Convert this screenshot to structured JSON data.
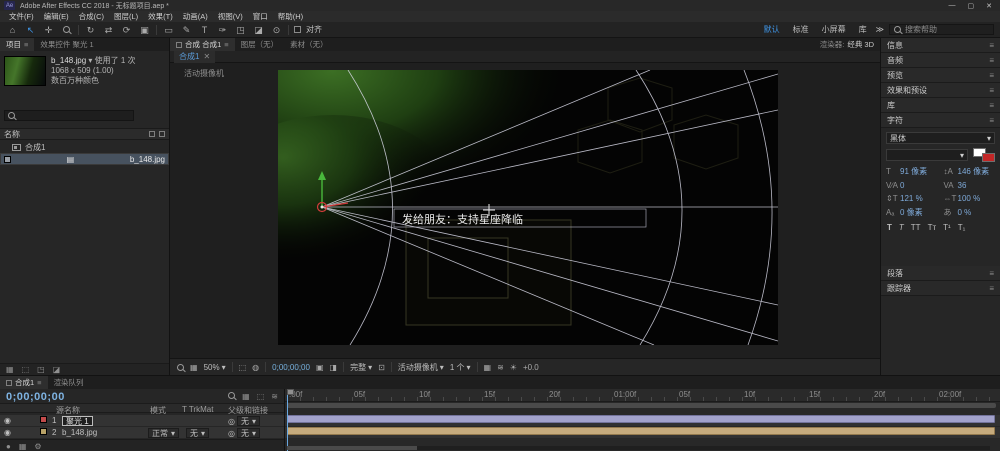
{
  "colors": {
    "accent_blue": "#3f96e8",
    "timecode_blue": "#7eb3e2",
    "layer_bar_lavender": "#a2a2cb",
    "layer_bar_tan": "#c6ab7d"
  },
  "icons": {
    "menu": "≡",
    "chevron": "▾",
    "close": "✕",
    "minimize": "—",
    "maximize": "▢",
    "home": "⌂",
    "selection": "↖",
    "hand": "✛",
    "orbit": "↻",
    "pan": "⇄",
    "rotate": "⟳",
    "camera_tool": "▣",
    "rect_tool": "▭",
    "pen_tool": "✎",
    "type_tool": "T",
    "brush_tool": "✑",
    "stamp_tool": "◳",
    "eraser_tool": "◪",
    "puppet_tool": "⊙",
    "overflow": "≫",
    "grid": "▦",
    "safe_margins": "⬚",
    "channels": "◍",
    "snapshot": "▣",
    "split_view": "◨",
    "roi": "⊡",
    "gear": "⚙",
    "sun": "☀",
    "eye": "◉",
    "pickwhip": "◎",
    "film": "▤",
    "solo_dot": "●",
    "quality": "≋"
  },
  "titlebar": {
    "app_badge": "Ae",
    "title": "Adobe After Effects CC 2018 - 无标题项目.aep *"
  },
  "menubar": {
    "items": [
      "文件(F)",
      "编辑(E)",
      "合成(C)",
      "图层(L)",
      "效果(T)",
      "动画(A)",
      "视图(V)",
      "窗口",
      "帮助(H)"
    ]
  },
  "toolbar": {
    "snap_label": "对齐",
    "workspaces": [
      "默认",
      "标准",
      "小屏幕",
      "库"
    ],
    "search_placeholder": "搜索帮助"
  },
  "project": {
    "tab_project": "项目",
    "tab_effect_controls": "效果控件 聚光 1",
    "preview_name": "b_148.jpg",
    "preview_usage": "使用了 1 次",
    "preview_dimensions": "1068 x 509 (1.00)",
    "preview_depth": "数百万种颜色",
    "list_header": "名称",
    "item_comp": "合成1",
    "item_footage": "b_148.jpg"
  },
  "viewer": {
    "tab_comp": "合成 合成1",
    "tab_layer": "图层（无）",
    "tab_footage": "素材（无）",
    "renderer_label": "渲染器:",
    "renderer_value": "经典 3D",
    "viewer_tab": "合成1",
    "camera_label": "活动摄像机",
    "overlay_text": "发给朋友：支持星座降临",
    "zoom": "50%",
    "timecode": "0;00;00;00",
    "resolution": "完整",
    "view_name": "活动摄像机",
    "view_count": "1 个",
    "exposure": "+0.0"
  },
  "panels": {
    "info": "信息",
    "audio": "音频",
    "preview": "预览",
    "effects_presets": "效果和预设",
    "libraries": "库",
    "character_title": "字符",
    "font_family": "黑体",
    "font_style": "",
    "font_size": "91 像素",
    "leading": "146 像素",
    "kerning": "0",
    "tracking": "36",
    "vertical_scale": "121 %",
    "horizontal_scale": "100 %",
    "baseline_shift": "0 像素",
    "tsume": "0 %",
    "toggle_faux_bold": "T",
    "toggle_faux_italic": "T",
    "toggle_all_caps": "TT",
    "toggle_small_caps": "Tᴛ",
    "toggle_superscript": "T¹",
    "toggle_subscript": "T₁",
    "paragraph": "段落",
    "tracker": "跟踪器"
  },
  "timeline": {
    "tab_comp": "合成1",
    "tab_render_queue": "渲染队列",
    "timecode": "0;00;00;00",
    "col_source_name": "源名称",
    "col_mode": "模式",
    "col_trkmat": "T TrkMat",
    "col_parent": "父级和链接",
    "layer1_index": "1",
    "layer1_name": "聚光 1",
    "layer1_parent": "无",
    "layer2_index": "2",
    "layer2_name": "b_148.jpg",
    "layer2_mode": "正常",
    "layer2_trkmat": "无",
    "layer2_parent": "无",
    "ruler": [
      ":00f",
      "05f",
      "10f",
      "15f",
      "20f",
      "01:00f",
      "05f",
      "10f",
      "15f",
      "20f",
      "02:00f"
    ]
  }
}
